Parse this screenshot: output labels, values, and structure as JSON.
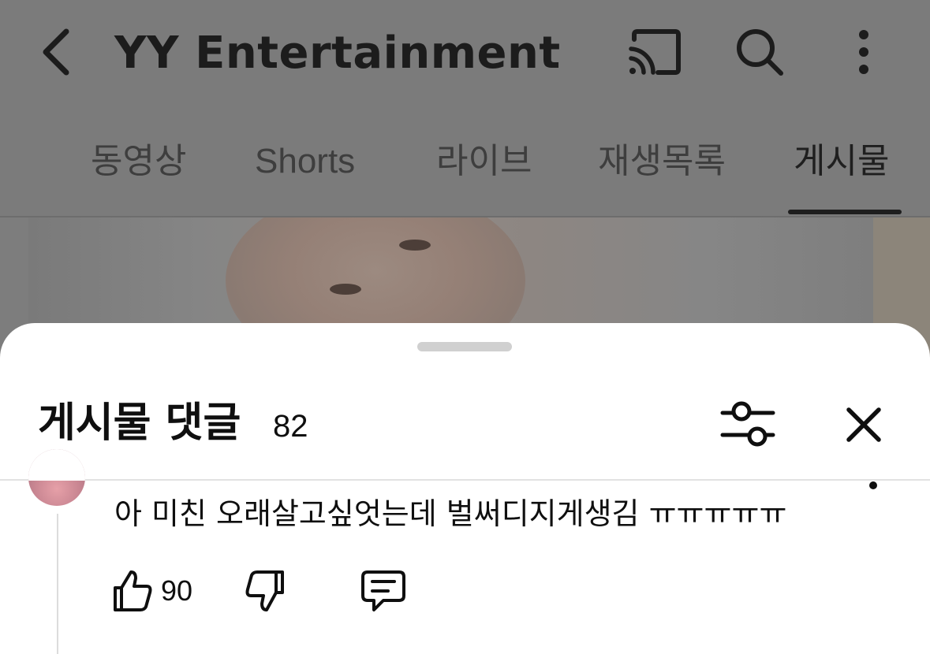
{
  "header": {
    "channel_title": "YY Entertainment",
    "icons": [
      "back-arrow-icon",
      "cast-icon",
      "search-icon",
      "more-vertical-icon"
    ]
  },
  "tabs": [
    {
      "label": "동영상",
      "active": false
    },
    {
      "label": "Shorts",
      "active": false
    },
    {
      "label": "라이브",
      "active": false
    },
    {
      "label": "재생목록",
      "active": false
    },
    {
      "label": "게시물",
      "active": true
    }
  ],
  "sheet": {
    "title": "게시물 댓글",
    "count": "82",
    "icons": [
      "filter-sliders-icon",
      "close-icon"
    ]
  },
  "comment": {
    "text": "아 미친 오래살고싶엇는데 벌써디지게생김 ㅠㅠㅠㅠㅠ",
    "likes": "90",
    "icons": [
      "thumbs-up-icon",
      "thumbs-down-icon",
      "reply-icon",
      "more-icon"
    ]
  },
  "colors": {
    "overlay": "#7b7b7b",
    "sheet_background": "#ffffff",
    "text": "#0f0f0f",
    "tab_active_underline": "#1e1e1e"
  }
}
